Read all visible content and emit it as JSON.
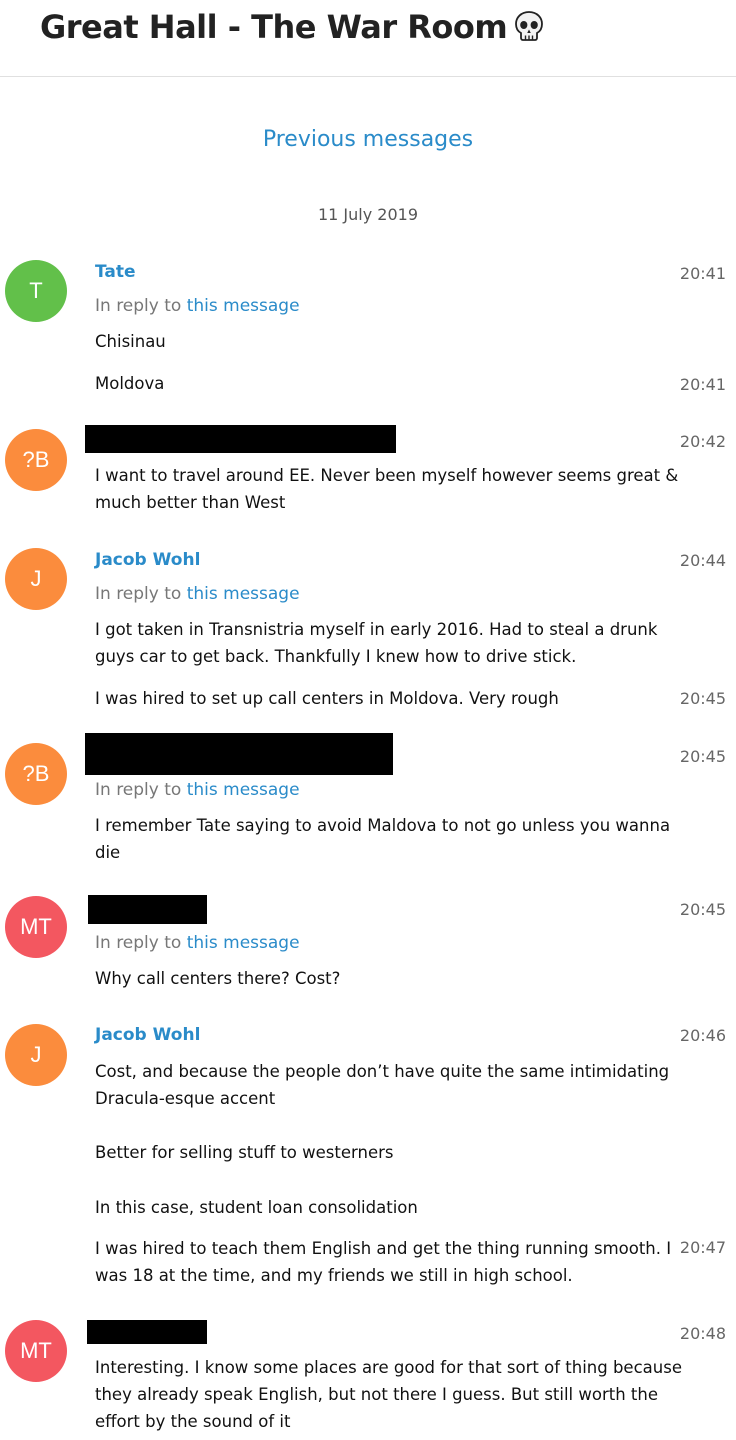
{
  "header": {
    "title": "Great Hall - The War Room",
    "icon": "skull-icon"
  },
  "history": {
    "previous_label": "Previous messages"
  },
  "date_separator": "11 July 2019",
  "reply_prefix": "In reply to",
  "reply_link": "this message",
  "colors": {
    "link": "#2a8bc9",
    "avatar_green": "#62c04a",
    "avatar_orange": "#fb8c3d",
    "avatar_red": "#f35760"
  },
  "messages": [
    {
      "avatar": "T",
      "from": "Tate",
      "time": "20:41",
      "lines": [
        {
          "text": "Chisinau"
        },
        {
          "text": "Moldova",
          "time": "20:41"
        }
      ]
    },
    {
      "avatar": "?B",
      "from": "",
      "time": "20:42",
      "lines": [
        {
          "text": "I want to travel around EE. Never been myself however seems great & much better than West"
        }
      ]
    },
    {
      "avatar": "J",
      "from": "Jacob Wohl",
      "time": "20:44",
      "lines": [
        {
          "text": "I got taken in Transnistria myself in early 2016. Had to steal a drunk guys car to get back. Thankfully I knew how to drive stick."
        },
        {
          "text": "I was hired to set up call centers in Moldova. Very rough",
          "time": "20:45"
        }
      ]
    },
    {
      "avatar": "?B",
      "from": "",
      "time": "20:45",
      "lines": [
        {
          "text": "I remember Tate saying to avoid Maldova to not go unless you wanna die"
        }
      ]
    },
    {
      "avatar": "MT",
      "from": "",
      "time": "20:45",
      "lines": [
        {
          "text": "Why call centers there? Cost?"
        }
      ]
    },
    {
      "avatar": "J",
      "from": "Jacob Wohl",
      "time": "20:46",
      "lines": [
        {
          "text": "Cost, and because the people don’t have quite the same intimidating Dracula-esque accent"
        },
        {
          "text": "Better for selling stuff to westerners"
        },
        {
          "text": "In this case, student loan consolidation"
        },
        {
          "text": "I was hired to teach them English and get the thing running smooth. I was 18 at the time, and my friends we still in high school.",
          "time": "20:47"
        }
      ]
    },
    {
      "avatar": "MT",
      "from": "",
      "time": "20:48",
      "lines": [
        {
          "text": "Interesting. I know some places are good for that sort of thing because they already speak English, but not there I guess. But still worth the effort by the sound of it"
        }
      ]
    }
  ]
}
